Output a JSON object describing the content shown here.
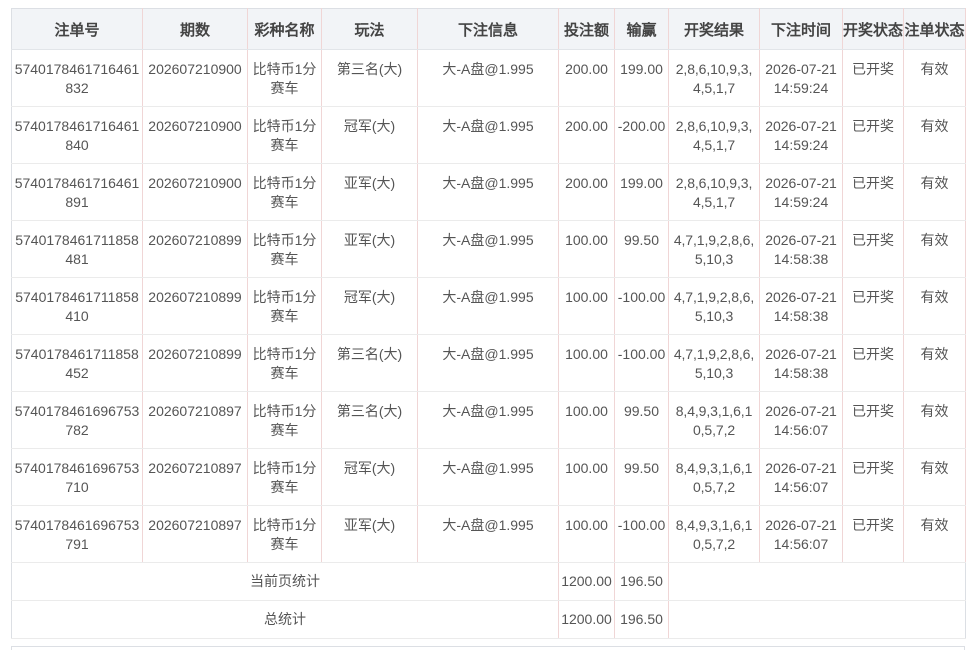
{
  "table": {
    "columns": {
      "order_no": "注单号",
      "period": "期数",
      "lottery": "彩种名称",
      "play": "玩法",
      "bet_info": "下注信息",
      "amount": "投注额",
      "win_loss": "输赢",
      "result": "开奖结果",
      "bet_time": "下注时间",
      "draw_status": "开奖状态",
      "order_status": "注单状态"
    },
    "rows": [
      {
        "order_no": "5740178461716461832",
        "period": "202607210900",
        "lottery": "比特币1分赛车",
        "play": "第三名(大)",
        "bet_info": "大-A盘@1.995",
        "amount": "200.00",
        "win_loss": "199.00",
        "result": "2,8,6,10,9,3,4,5,1,7",
        "bet_time": "2026-07-21 14:59:24",
        "draw_status": "已开奖",
        "order_status": "有效"
      },
      {
        "order_no": "5740178461716461840",
        "period": "202607210900",
        "lottery": "比特币1分赛车",
        "play": "冠军(大)",
        "bet_info": "大-A盘@1.995",
        "amount": "200.00",
        "win_loss": "-200.00",
        "result": "2,8,6,10,9,3,4,5,1,7",
        "bet_time": "2026-07-21 14:59:24",
        "draw_status": "已开奖",
        "order_status": "有效"
      },
      {
        "order_no": "5740178461716461891",
        "period": "202607210900",
        "lottery": "比特币1分赛车",
        "play": "亚军(大)",
        "bet_info": "大-A盘@1.995",
        "amount": "200.00",
        "win_loss": "199.00",
        "result": "2,8,6,10,9,3,4,5,1,7",
        "bet_time": "2026-07-21 14:59:24",
        "draw_status": "已开奖",
        "order_status": "有效"
      },
      {
        "order_no": "5740178461711858481",
        "period": "202607210899",
        "lottery": "比特币1分赛车",
        "play": "亚军(大)",
        "bet_info": "大-A盘@1.995",
        "amount": "100.00",
        "win_loss": "99.50",
        "result": "4,7,1,9,2,8,6,5,10,3",
        "bet_time": "2026-07-21 14:58:38",
        "draw_status": "已开奖",
        "order_status": "有效"
      },
      {
        "order_no": "5740178461711858410",
        "period": "202607210899",
        "lottery": "比特币1分赛车",
        "play": "冠军(大)",
        "bet_info": "大-A盘@1.995",
        "amount": "100.00",
        "win_loss": "-100.00",
        "result": "4,7,1,9,2,8,6,5,10,3",
        "bet_time": "2026-07-21 14:58:38",
        "draw_status": "已开奖",
        "order_status": "有效"
      },
      {
        "order_no": "5740178461711858452",
        "period": "202607210899",
        "lottery": "比特币1分赛车",
        "play": "第三名(大)",
        "bet_info": "大-A盘@1.995",
        "amount": "100.00",
        "win_loss": "-100.00",
        "result": "4,7,1,9,2,8,6,5,10,3",
        "bet_time": "2026-07-21 14:58:38",
        "draw_status": "已开奖",
        "order_status": "有效"
      },
      {
        "order_no": "5740178461696753782",
        "period": "202607210897",
        "lottery": "比特币1分赛车",
        "play": "第三名(大)",
        "bet_info": "大-A盘@1.995",
        "amount": "100.00",
        "win_loss": "99.50",
        "result": "8,4,9,3,1,6,10,5,7,2",
        "bet_time": "2026-07-21 14:56:07",
        "draw_status": "已开奖",
        "order_status": "有效"
      },
      {
        "order_no": "5740178461696753710",
        "period": "202607210897",
        "lottery": "比特币1分赛车",
        "play": "冠军(大)",
        "bet_info": "大-A盘@1.995",
        "amount": "100.00",
        "win_loss": "99.50",
        "result": "8,4,9,3,1,6,10,5,7,2",
        "bet_time": "2026-07-21 14:56:07",
        "draw_status": "已开奖",
        "order_status": "有效"
      },
      {
        "order_no": "5740178461696753791",
        "period": "202607210897",
        "lottery": "比特币1分赛车",
        "play": "亚军(大)",
        "bet_info": "大-A盘@1.995",
        "amount": "100.00",
        "win_loss": "-100.00",
        "result": "8,4,9,3,1,6,10,5,7,2",
        "bet_time": "2026-07-21 14:56:07",
        "draw_status": "已开奖",
        "order_status": "有效"
      }
    ],
    "summary": {
      "page": {
        "label": "当前页统计",
        "amount": "1200.00",
        "win_loss": "196.50"
      },
      "total": {
        "label": "总统计",
        "amount": "1200.00",
        "win_loss": "196.50"
      }
    }
  }
}
